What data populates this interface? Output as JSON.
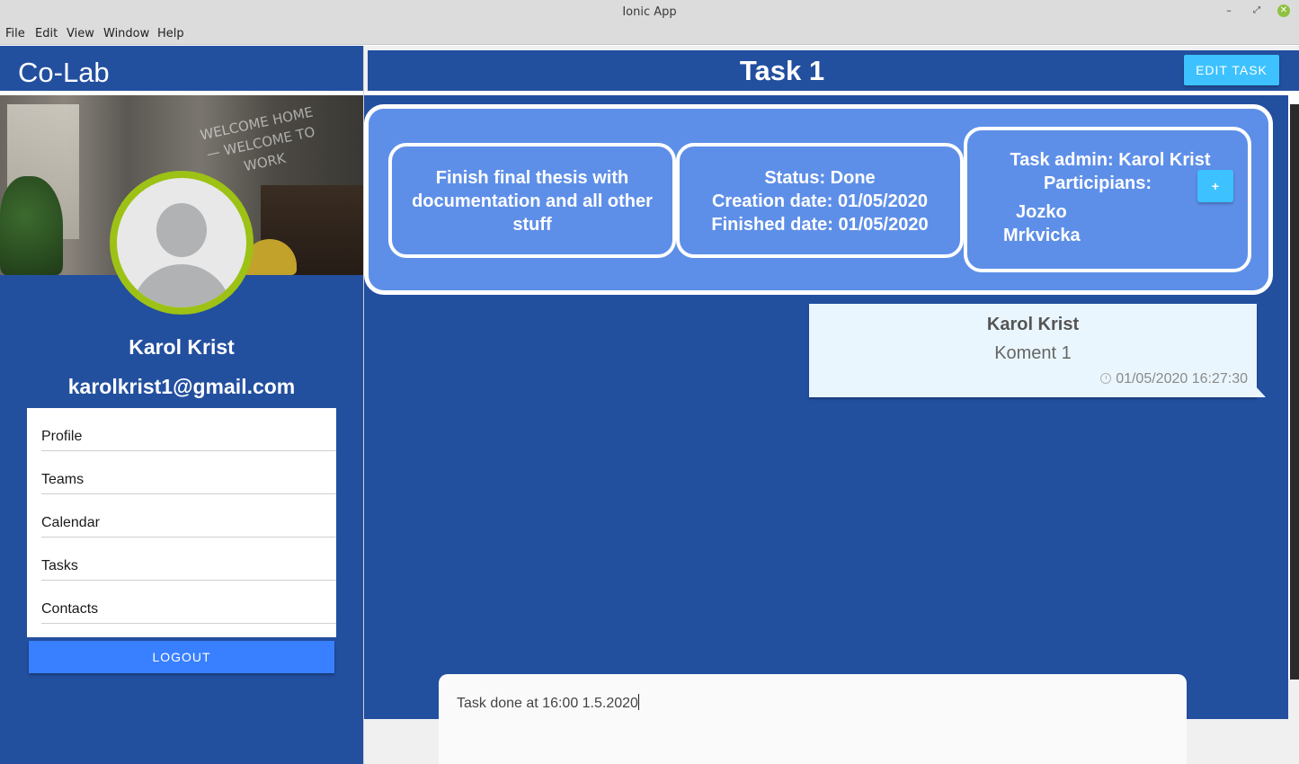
{
  "window": {
    "title": "Ionic App",
    "controls": {
      "minimize": "–",
      "maximize": "⤢",
      "close": "✕"
    }
  },
  "menubar": {
    "items": [
      "File",
      "Edit",
      "View",
      "Window",
      "Help"
    ]
  },
  "sidebar": {
    "app_title": "Co-Lab",
    "cover_neon": "WELCOME HOME — WELCOME TO WORK",
    "user": {
      "name": "Karol Krist",
      "email": "karolkrist1@gmail.com"
    },
    "items": [
      {
        "label": "Profile"
      },
      {
        "label": "Teams"
      },
      {
        "label": "Calendar"
      },
      {
        "label": "Tasks"
      },
      {
        "label": "Contacts"
      }
    ],
    "logout_label": "LOGOUT"
  },
  "header": {
    "title": "Task 1",
    "edit_label": "EDIT TASK"
  },
  "task": {
    "description": "Finish final thesis with documentation and all other stuff",
    "status": "Status: Done",
    "created": "Creation date: 01/05/2020",
    "finished": "Finished date: 01/05/2020",
    "admin": "Task admin: Karol Krist",
    "participants_label": "Participians:",
    "participants": [
      "Jozko",
      "Mrkvicka"
    ],
    "add_label": "+"
  },
  "comments": [
    {
      "author": "Karol Krist",
      "text": "Koment 1",
      "time": "01/05/2020 16:27:30"
    }
  ],
  "composer": {
    "value": "Task done at 16:00 1.5.2020"
  },
  "colors": {
    "primary_bg": "#234f9f",
    "card_bg": "#5e8fe8",
    "accent": "#3dc2ff",
    "logout": "#3880ff",
    "avatar_ring": "#9dc215"
  }
}
